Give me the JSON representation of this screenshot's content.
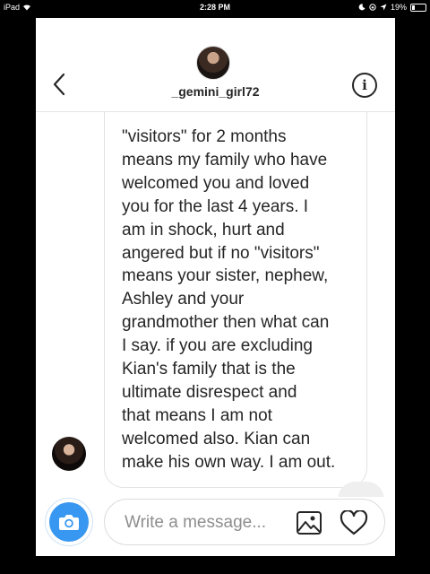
{
  "status_bar": {
    "device": "iPad",
    "time": "2:28 PM",
    "battery": "19%",
    "battery_level": 0.19
  },
  "header": {
    "username": "_gemini_girl72",
    "back_icon": "chevron-left-icon",
    "info_icon": "info-icon",
    "info_glyph": "i"
  },
  "conversation": {
    "message_text": "\"visitors\" for 2 months\nmeans my family who have\nwelcomed you and loved\nyou for the last 4 years. I\nam in shock, hurt and\nangered but if no \"visitors\"\nmeans your sister, nephew,\nAshley and your\ngrandmother then what can\nI say. if you are excluding\nKian's family that is the\nultimate disrespect and\nthat means I am not\nwelcomed also. Kian can\nmake his own way. I am out."
  },
  "composer": {
    "placeholder": "Write a message...",
    "camera_icon": "camera-icon",
    "gallery_icon": "gallery-icon",
    "heart_icon": "heart-icon",
    "accent_color": "#3897f0"
  }
}
